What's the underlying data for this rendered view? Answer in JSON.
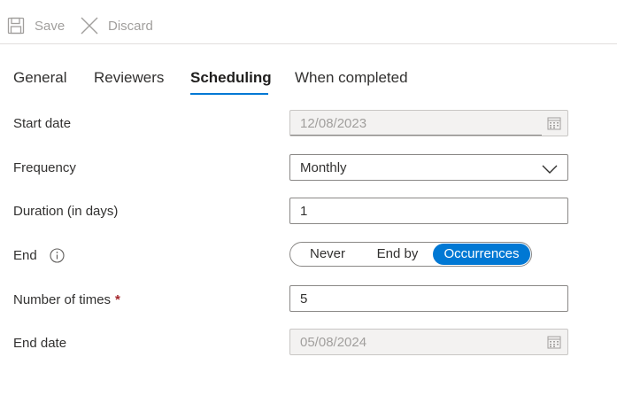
{
  "toolbar": {
    "save_label": "Save",
    "discard_label": "Discard",
    "save_icon": "save-icon",
    "discard_icon": "close-icon"
  },
  "tabs": [
    {
      "label": "General"
    },
    {
      "label": "Reviewers"
    },
    {
      "label": "Scheduling",
      "selected": true
    },
    {
      "label": "When completed"
    }
  ],
  "form": {
    "start_date": {
      "label": "Start date",
      "value": "12/08/2023",
      "disabled": true,
      "icon": "calendar-icon"
    },
    "frequency": {
      "label": "Frequency",
      "value": "Monthly",
      "icon": "chevron-down-icon"
    },
    "duration": {
      "label": "Duration (in days)",
      "value": "1"
    },
    "end": {
      "label": "End",
      "icon": "info-icon",
      "options": [
        "Never",
        "End by",
        "Occurrences"
      ],
      "selected": "Occurrences"
    },
    "number_of_times": {
      "label": "Number of times",
      "required_marker": "*",
      "value": "5"
    },
    "end_date": {
      "label": "End date",
      "value": "05/08/2024",
      "disabled": true,
      "icon": "calendar-icon"
    }
  },
  "colors": {
    "accent": "#0078d4",
    "required": "#a4262c",
    "disabled_bg": "#f3f2f1",
    "disabled_text": "#a19f9d"
  }
}
